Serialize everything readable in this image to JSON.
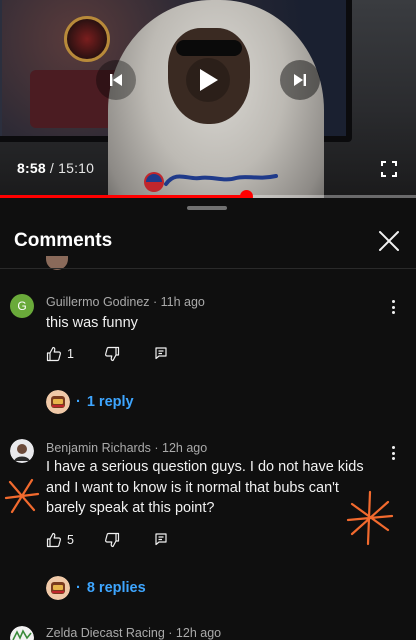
{
  "player": {
    "current_time": "8:58",
    "separator": " / ",
    "duration": "15:10",
    "progress_fraction": 0.591,
    "icons": [
      "previous-icon",
      "play-icon",
      "next-icon",
      "fullscreen-icon"
    ]
  },
  "comments_panel": {
    "title": "Comments",
    "close_icon": "close-icon"
  },
  "comments": [
    {
      "avatar_letter": "G",
      "avatar_color": "#6aaa3a",
      "author": "Guillermo Godinez",
      "time": "11h ago",
      "text": "this was funny",
      "likes": "1",
      "replies": "1 reply"
    },
    {
      "author": "Benjamin Richards",
      "time": "12h ago",
      "text": "I have a serious question guys. I do not have kids and I want to know is it normal that bubs can't barely speak at this point?",
      "likes": "5",
      "replies": "8 replies"
    },
    {
      "author": "Zelda Diecast Racing",
      "time": "12h ago"
    }
  ],
  "colors": {
    "background": "#0f0f0f",
    "accent_red": "#ff0000",
    "link_blue": "#3ea6ff",
    "annotation_orange": "#f26a2e"
  }
}
